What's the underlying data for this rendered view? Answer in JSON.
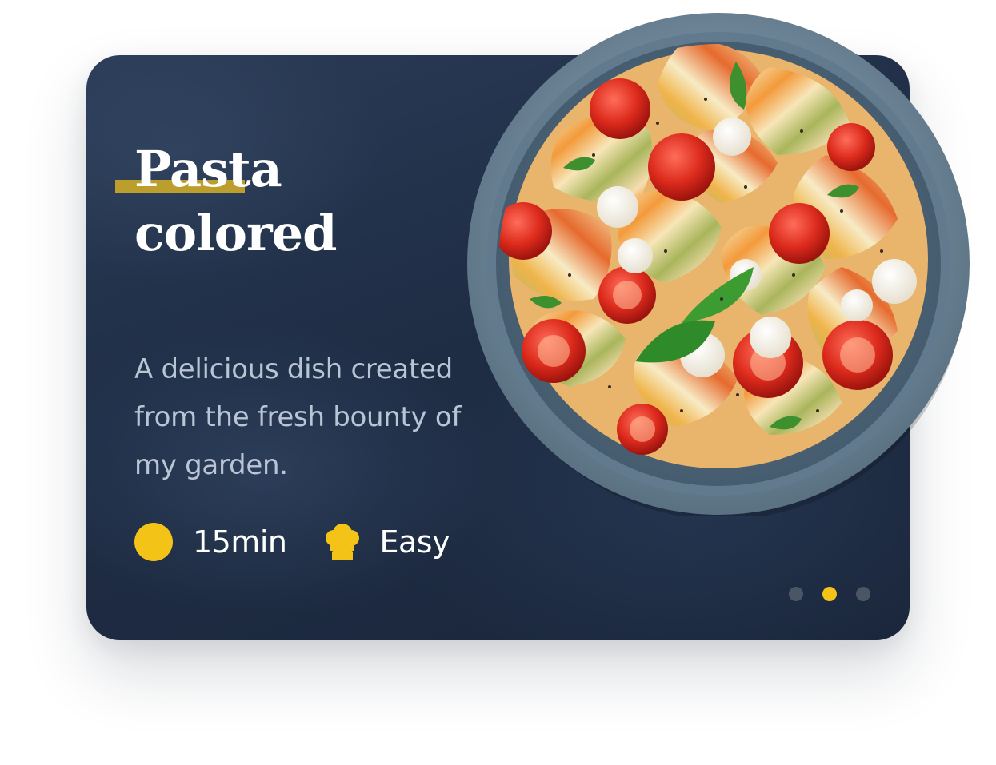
{
  "card": {
    "title_line1": "Pasta",
    "title_line2": "colored",
    "description": "A delicious dish created from the fresh bounty of my garden.",
    "time": "15min",
    "level": "Easy",
    "time_icon": "clock-circle-icon",
    "level_icon": "chef-hat-icon",
    "accent_color": "#f3c317",
    "background_color": "#1f2d45"
  },
  "pagination": {
    "count": 3,
    "active_index": 1
  }
}
